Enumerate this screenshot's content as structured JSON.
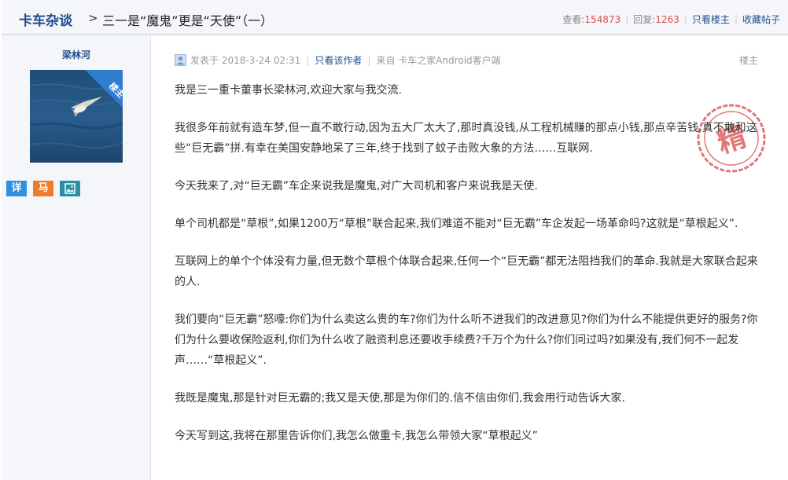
{
  "header": {
    "board": "卡车杂谈",
    "separator": ">",
    "title": "三一是“魔鬼”更是“天使”（一）",
    "views_label": "查看:",
    "views": "154873",
    "replies_label": "回复:",
    "replies": "1263",
    "only_op": "只看楼主",
    "favorite": "收藏帖子"
  },
  "sidebar": {
    "author": "梁林河",
    "badge": "楼主",
    "buttons": [
      "详",
      "马"
    ]
  },
  "post": {
    "posted": "发表于 2018-3-24 02:31",
    "only_author": "只看该作者",
    "source": "来自 卡车之家Android客户端",
    "floor": "楼主",
    "stamp_text": "精",
    "paragraphs": [
      "我是三一重卡董事长梁林河,欢迎大家与我交流.",
      "我很多年前就有造车梦,但一直不敢行动,因为五大厂太大了,那时真没钱,从工程机械赚的那点小钱,那点辛苦钱,真不敢和这些“巨无霸”拼.有幸在美国安静地呆了三年,终于找到了蚊子击败大象的方法……互联网.",
      "今天我来了,对“巨无霸”车企来说我是魔鬼,对广大司机和客户来说我是天使.",
      "单个司机都是“草根”,如果1200万“草根”联合起来,我们难道不能对“巨无霸”车企发起一场革命吗?这就是“草根起义”.",
      "互联网上的单个个体没有力量,但无数个草根个体联合起来,任何一个“巨无霸”都无法阻挡我们的革命.我就是大家联合起来的人.",
      "我们要向“巨无霸”怒嚎:你们为什么卖这么贵的车?你们为什么听不进我们的改进意见?你们为什么不能提供更好的服务?你们为什么要收保险返利,你们为什么收了融资利息还要收手续费?千万个为什么?你们问过吗?如果没有,我们何不一起发声……“草根起义”.",
      "我既是魔鬼,那是针对巨无霸的;我又是天使,那是为你们的.信不信由你们,我会用行动告诉大家.",
      "今天写到这,我将在那里告诉你们,我怎么做重卡,我怎么带领大家“草根起义”"
    ]
  },
  "colors": {
    "link": "#1f4e8c",
    "count": "#d9534f",
    "badge": "#2e7dd1",
    "stamp": "#d84a4a"
  },
  "icons": [
    "user-icon",
    "image-icon",
    "avatar-bird-photo"
  ]
}
